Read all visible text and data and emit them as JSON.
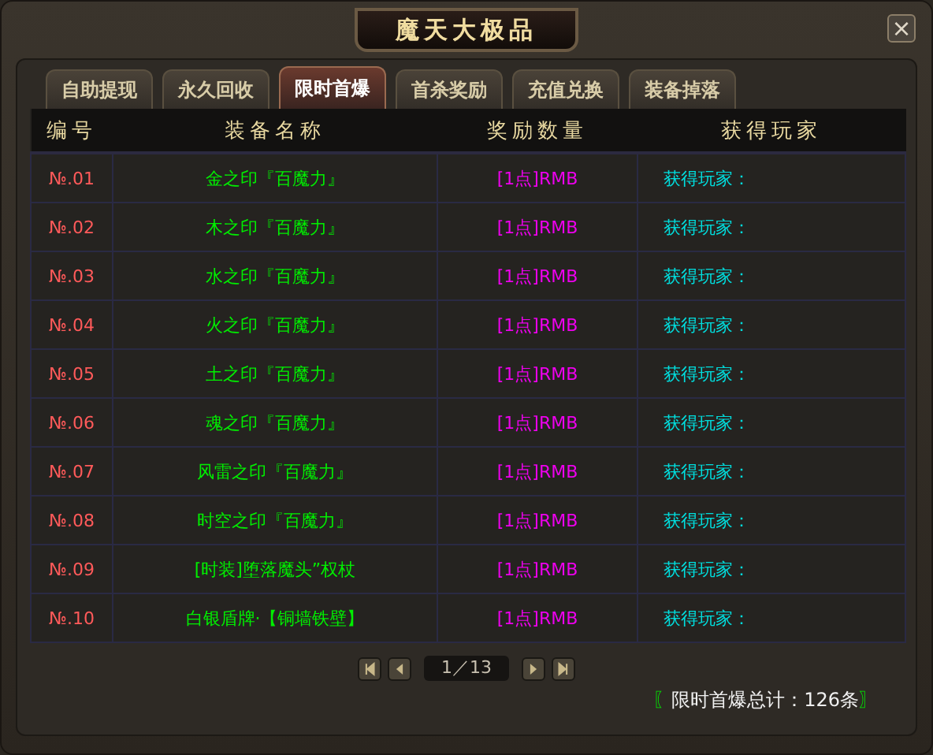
{
  "window": {
    "title": "魔天大极品",
    "close": "×"
  },
  "tabs": [
    {
      "label": "自助提现",
      "selected": false
    },
    {
      "label": "永久回收",
      "selected": false
    },
    {
      "label": "限时首爆",
      "selected": true
    },
    {
      "label": "首杀奖励",
      "selected": false
    },
    {
      "label": "充值兑换",
      "selected": false
    },
    {
      "label": "装备掉落",
      "selected": false
    }
  ],
  "table": {
    "columns": [
      "编号",
      "装备名称",
      "奖励数量",
      "获得玩家"
    ],
    "rows": [
      [
        "№.01",
        "金之印『百魔力』",
        "[1点]RMB",
        "获得玩家："
      ],
      [
        "№.02",
        "木之印『百魔力』",
        "[1点]RMB",
        "获得玩家："
      ],
      [
        "№.03",
        "水之印『百魔力』",
        "[1点]RMB",
        "获得玩家："
      ],
      [
        "№.04",
        "火之印『百魔力』",
        "[1点]RMB",
        "获得玩家："
      ],
      [
        "№.05",
        "土之印『百魔力』",
        "[1点]RMB",
        "获得玩家："
      ],
      [
        "№.06",
        "魂之印『百魔力』",
        "[1点]RMB",
        "获得玩家："
      ],
      [
        "№.07",
        "风雷之印『百魔力』",
        "[1点]RMB",
        "获得玩家："
      ],
      [
        "№.08",
        "时空之印『百魔力』",
        "[1点]RMB",
        "获得玩家："
      ],
      [
        "№.09",
        "[时装]堕落魔头”权杖",
        "[1点]RMB",
        "获得玩家："
      ],
      [
        "№.10",
        "白银盾牌·【铜墙铁壁】",
        "[1点]RMB",
        "获得玩家："
      ]
    ]
  },
  "pager": {
    "page": "1／13"
  },
  "total": {
    "open": "〖",
    "text": "限时首爆总计：126条",
    "close": "〗"
  }
}
